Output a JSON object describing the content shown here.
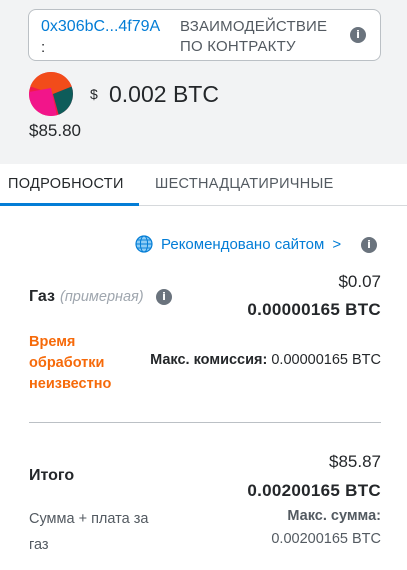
{
  "contract": {
    "address": "0x306bC...4f79A",
    "address_suffix": ":",
    "interaction_label": "ВЗАИМОДЕЙСТВИЕ ПО КОНТРАКТУ",
    "info_icon": "info-icon"
  },
  "transaction": {
    "symbol": "$",
    "amount": "0.002 BTC",
    "fiat": "$85.80"
  },
  "tabs": [
    {
      "label": "ПОДРОБНОСТИ",
      "active": true
    },
    {
      "label": "ШЕСТНАДЦАТИРИЧНЫЕ",
      "active": false
    }
  ],
  "recommendation": {
    "label": "Рекомендовано сайтом",
    "chevron": ">",
    "icon": "globe-icon"
  },
  "gas": {
    "label": "Газ",
    "sublabel": "(примерная)",
    "fiat": "$0.07",
    "amount": "0.00000165 BTC",
    "time_warning": "Время обработки неизвестно",
    "max_fee_label": "Макс. комиссия:",
    "max_fee_value": "0.00000165 BTC"
  },
  "total": {
    "label": "Итого",
    "fiat": "$85.87",
    "amount": "0.00200165 BTC",
    "sublabel": "Сумма + плата за газ",
    "max_sum_label": "Макс. сумма:",
    "max_sum_value": "0.00200165 BTC"
  },
  "colors": {
    "accent": "#037dd6",
    "warning": "#f66a0a",
    "header_bg": "#f2f3f4"
  }
}
